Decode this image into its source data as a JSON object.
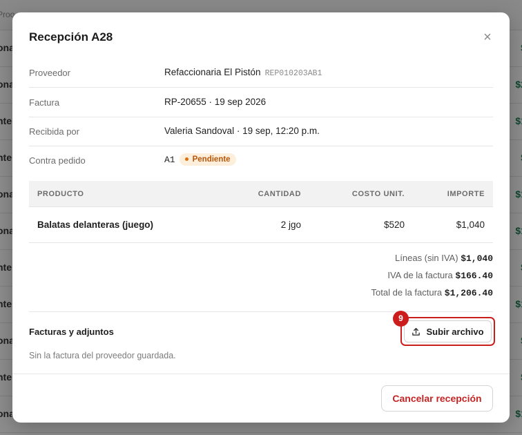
{
  "background": {
    "header_left": "Proo",
    "rows": [
      {
        "left": "ona",
        "right": "$"
      },
      {
        "left": "ona",
        "right": "$2"
      },
      {
        "left": "nte",
        "right": "$1"
      },
      {
        "left": "nte",
        "right": "$"
      },
      {
        "left": "ona",
        "right": "$1"
      },
      {
        "left": "ona",
        "right": "$1"
      },
      {
        "left": "nte",
        "right": "$"
      },
      {
        "left": "nte",
        "right": "$1"
      },
      {
        "left": "ona",
        "right": "$"
      },
      {
        "left": "nte",
        "right": "$"
      },
      {
        "left": "ona",
        "right": "$1"
      }
    ]
  },
  "modal": {
    "title": "Recepción A28",
    "close_glyph": "×",
    "info": {
      "supplier_label": "Proveedor",
      "supplier_name": "Refaccionaria El Pistón",
      "supplier_rfc": "REP010203AB1",
      "invoice_label": "Factura",
      "invoice_value": "RP-20655 · 19 sep 2026",
      "received_label": "Recibida por",
      "received_value": "Valeria Sandoval · 19 sep, 12:20 p.m.",
      "po_label": "Contra pedido",
      "po_value": "A1",
      "po_status": "Pendiente"
    },
    "table": {
      "headers": {
        "product": "PRODUCTO",
        "quantity": "CANTIDAD",
        "unit_cost": "COSTO UNIT.",
        "amount": "IMPORTE"
      },
      "rows": [
        {
          "product": "Balatas delanteras (juego)",
          "quantity": "2 jgo",
          "unit_cost": "$520",
          "amount": "$1,040"
        }
      ]
    },
    "totals": {
      "lines_label": "Líneas (sin IVA)",
      "lines_value": "$1,040",
      "vat_label": "IVA de la factura",
      "vat_value": "$166.40",
      "total_label": "Total de la factura",
      "total_value": "$1,206.40"
    },
    "attachments": {
      "title": "Facturas y adjuntos",
      "empty_note": "Sin la factura del proveedor guardada.",
      "upload_label": "Subir archivo",
      "step_number": "9"
    },
    "cancel_label": "Cancelar recepción"
  },
  "colors": {
    "danger": "#cc1d1d",
    "badge_bg": "#fdefdc",
    "badge_text": "#b8560a",
    "bg_amount": "#1e7a52"
  },
  "icons": {
    "close": "close-icon",
    "upload": "upload-icon",
    "status_dot": "status-dot-icon"
  }
}
